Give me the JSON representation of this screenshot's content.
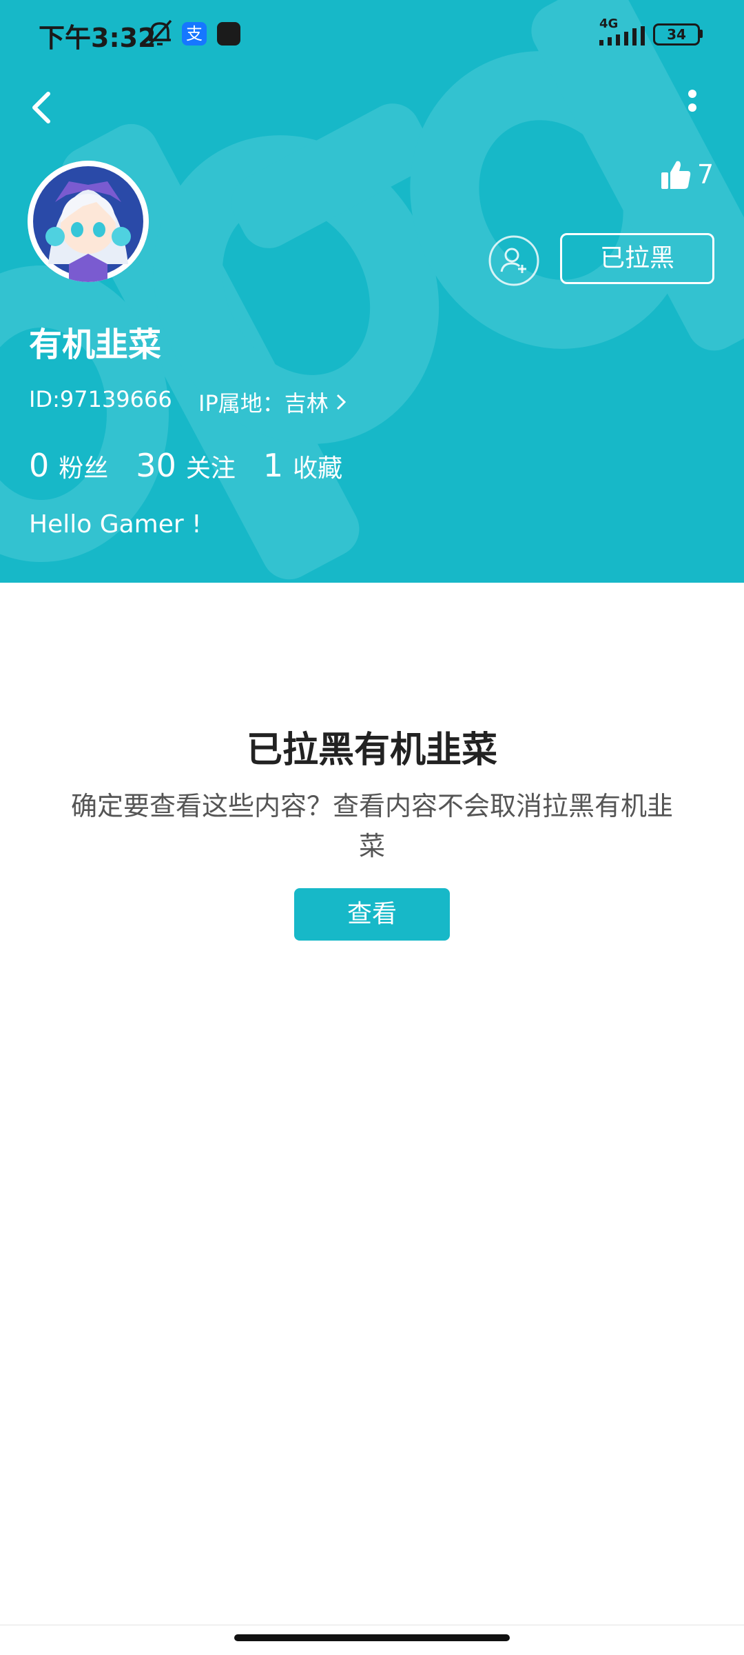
{
  "status_bar": {
    "time": "下午3:32",
    "network": "4G",
    "battery": "34",
    "icons": [
      "bell-off-icon",
      "alipay-icon",
      "taptap-icon",
      "signal-icon",
      "battery-icon"
    ]
  },
  "header": {
    "like_count": "7",
    "blocked_button": "已拉黑",
    "username": "有机韭菜",
    "user_id": "ID:97139666",
    "ip_location": "IP属地：吉林",
    "stats": [
      {
        "value": "0",
        "label": "粉丝"
      },
      {
        "value": "30",
        "label": "关注"
      },
      {
        "value": "1",
        "label": "收藏"
      }
    ],
    "bio": "Hello Gamer !"
  },
  "notice": {
    "title": "已拉黑有机韭菜",
    "description": "确定要查看这些内容？查看内容不会取消拉黑有机韭菜",
    "view_button": "查看"
  },
  "colors": {
    "accent": "#17b8c8",
    "watermark": "#2fc3d1"
  }
}
